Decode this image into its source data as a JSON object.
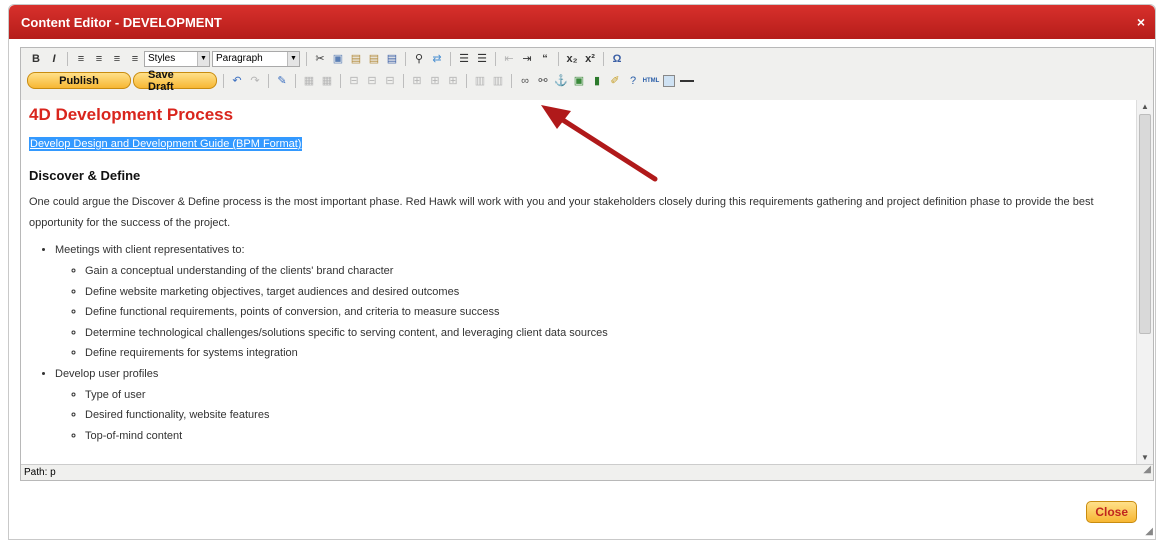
{
  "window": {
    "title": "Content Editor - DEVELOPMENT",
    "close_glyph": "×"
  },
  "toolbar1": {
    "styles_value": "Styles",
    "format_value": "Paragraph"
  },
  "toolbar2": {
    "publish_label": "Publish",
    "save_draft_label": "Save Draft"
  },
  "document": {
    "heading": "4D Development Process",
    "link_text": "Develop Design and Development Guide (BPM Format)",
    "subheading": "Discover & Define",
    "paragraph": "One could argue the Discover & Define process is the most important phase. Red Hawk will work with you and your stakeholders closely during this requirements gathering and project definition phase to provide the best opportunity for the success of the project.",
    "list": [
      {
        "label": "Meetings with client representatives to:",
        "children": [
          "Gain a conceptual understanding of the clients' brand character",
          "Define website marketing objectives, target audiences and desired outcomes",
          "Define functional requirements, points of conversion, and criteria to measure success",
          "Determine technological challenges/solutions specific to serving content, and leveraging client data sources",
          "Define requirements for systems integration"
        ]
      },
      {
        "label": "Develop user profiles",
        "children": [
          "Type of user",
          "Desired functionality, website features",
          "Top-of-mind content"
        ]
      }
    ]
  },
  "status": {
    "path": "Path: p"
  },
  "footer": {
    "close_label": "Close"
  },
  "colors": {
    "title_bar": "#c62824",
    "heading": "#d9251d",
    "selection": "#3399ff",
    "button": "#f7b733"
  },
  "icons": [
    "bold-icon",
    "italic-icon",
    "align-left-icon",
    "align-center-icon",
    "align-right-icon",
    "align-justify-icon",
    "cut-icon",
    "copy-icon",
    "paste-icon",
    "paste-text-icon",
    "paste-word-icon",
    "find-icon",
    "replace-icon",
    "bullet-list-icon",
    "numbered-list-icon",
    "outdent-icon",
    "indent-icon",
    "blockquote-icon",
    "subscript-icon",
    "superscript-icon",
    "special-char-icon",
    "undo-icon",
    "redo-icon",
    "edit-icon",
    "table-icon",
    "link-icon",
    "unlink-icon",
    "anchor-icon",
    "image-icon",
    "media-icon",
    "cleanup-icon",
    "help-icon",
    "html-icon",
    "fullscreen-icon",
    "horizontal-rule-icon"
  ]
}
